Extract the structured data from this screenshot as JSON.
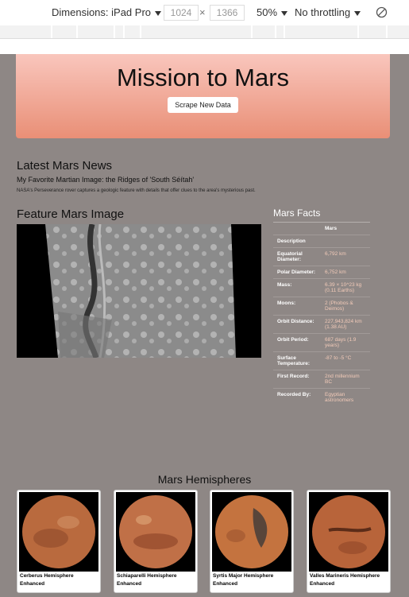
{
  "toolbar": {
    "device": "Dimensions: iPad Pro",
    "width": "1024",
    "times": "×",
    "height": "1366",
    "zoom": "50%",
    "throttle": "No throttling"
  },
  "header": {
    "title": "Mission to Mars",
    "button": "Scrape New Data"
  },
  "news": {
    "heading": "Latest Mars News",
    "title": "My Favorite Martian Image: the Ridges of 'South Séítah'",
    "teaser": "NASA's Perseverance rover captures a geologic feature with details that offer clues to the area's mysterious past."
  },
  "featured": {
    "heading": "Feature Mars Image"
  },
  "facts": {
    "heading": "Mars Facts",
    "col_header": "Mars",
    "rows": [
      {
        "label": "Description",
        "value": ""
      },
      {
        "label": "Equatorial Diameter:",
        "value": "6,792 km"
      },
      {
        "label": "Polar Diameter:",
        "value": "6,752 km"
      },
      {
        "label": "Mass:",
        "value": "6.39 × 10^23 kg (0.11 Earths)"
      },
      {
        "label": "Moons:",
        "value": "2 (Phobos & Deimos)"
      },
      {
        "label": "Orbit Distance:",
        "value": "227,943,824 km (1.38 AU)"
      },
      {
        "label": "Orbit Period:",
        "value": "687 days (1.9 years)"
      },
      {
        "label": "Surface Temperature:",
        "value": "-87 to -5 °C"
      },
      {
        "label": "First Record:",
        "value": "2nd millennium BC"
      },
      {
        "label": "Recorded By:",
        "value": "Egyptian astronomers"
      }
    ]
  },
  "hemispheres": {
    "heading": "Mars Hemispheres",
    "items": [
      {
        "title": "Cerberus Hemisphere Enhanced"
      },
      {
        "title": "Schiaparelli Hemisphere Enhanced"
      },
      {
        "title": "Syrtis Major Hemisphere Enhanced"
      },
      {
        "title": "Valles Marineris Hemisphere Enhanced"
      }
    ]
  },
  "colors": {
    "page_bg": "#8e8785",
    "jumbo_top": "#f9c6bd",
    "jumbo_bottom": "#e98f76",
    "fact_value": "#f3cbb9"
  },
  "icons": {
    "throttle_toggle": "no-rotate-icon"
  }
}
